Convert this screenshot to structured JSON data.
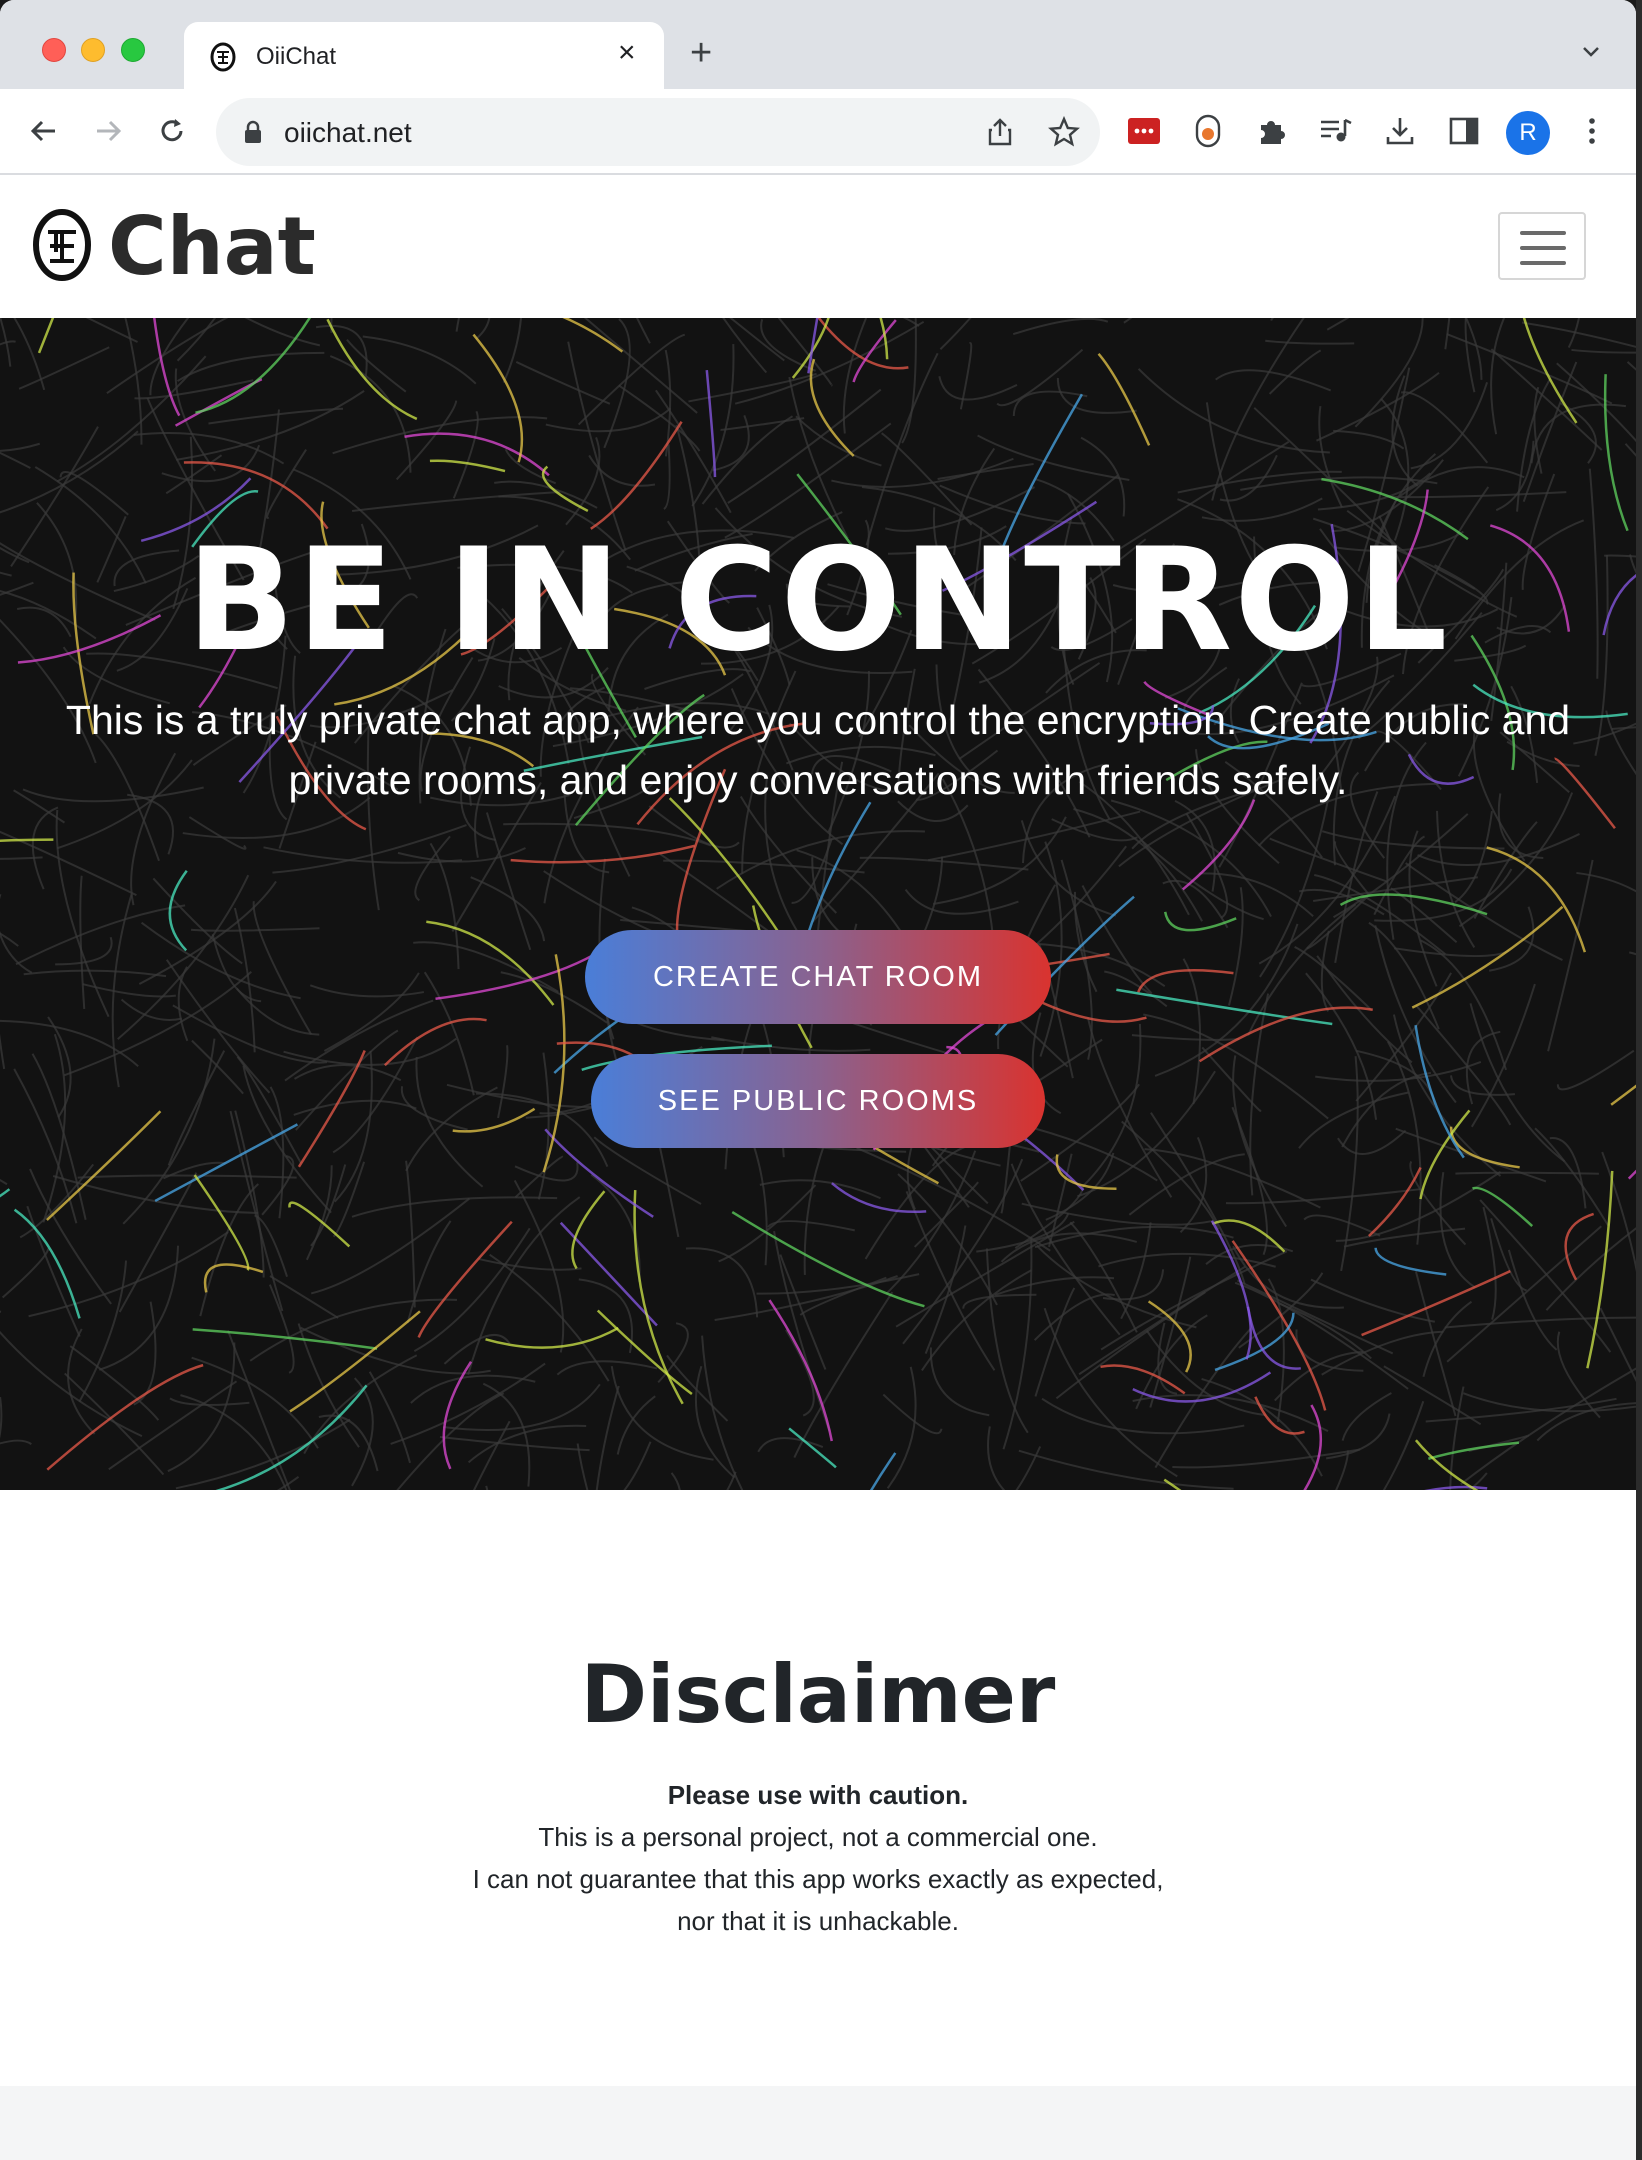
{
  "browser": {
    "tab_title": "OiiChat",
    "url": "oiichat.net",
    "avatar_letter": "R"
  },
  "site": {
    "brand": "Chat"
  },
  "hero": {
    "title": "BE IN CONTROL",
    "subtitle_line1": "This is a truly private chat app, where you control the encryption. Create public and",
    "subtitle_line2": "private rooms, and enjoy conversations with friends safely.",
    "create_button": "CREATE CHAT ROOM",
    "public_button": "SEE PUBLIC ROOMS"
  },
  "disclaimer": {
    "title": "Disclaimer",
    "caution": "Please use with caution.",
    "line1": "This is a personal project, not a commercial one.",
    "line2": "I can not guarantee that this app works exactly as expected,",
    "line3": "nor that it is unhackable."
  },
  "colors": {
    "button_gradient_start": "#4a7ed8",
    "button_gradient_end": "#d9332f",
    "hero_background": "#121212"
  }
}
